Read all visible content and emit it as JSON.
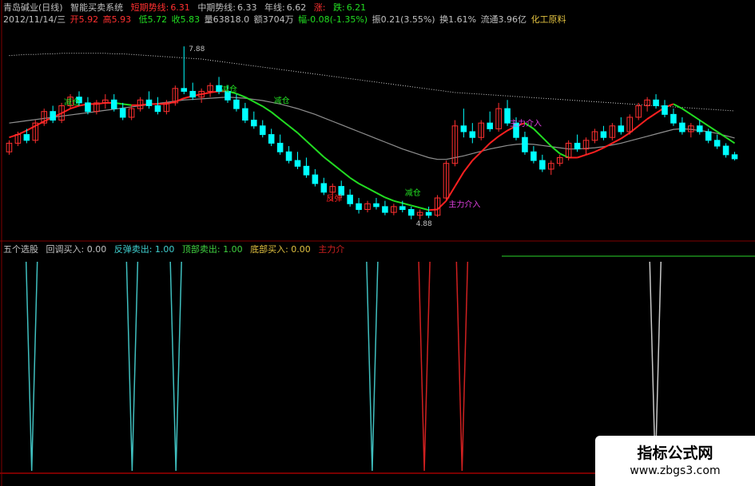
{
  "header": {
    "stock": "青岛碱业(日线)",
    "system": "智能买卖系统",
    "short_label": "短期势线:",
    "short_val": "6.31",
    "mid_label": "中期势线:",
    "mid_val": "6.33",
    "year_label": "年线:",
    "year_val": "6.62",
    "up_label": "涨:",
    "down_label": "跌:",
    "down_val": "6.21"
  },
  "quote": {
    "date": "2012/11/14/三",
    "open": "开5.92",
    "high": "高5.93",
    "low": "低5.72",
    "close": "收5.83",
    "vol": "量63818.0",
    "amount": "额3704万",
    "change": "幅-0.08(-1.35%)",
    "amplitude": "振0.21(3.55%)",
    "turnover": "换1.61%",
    "float": "流通3.96亿",
    "sector": "化工原料"
  },
  "indicator": {
    "name": "五个选股",
    "pullback": "回调买入: 0.00",
    "rebound": "反弹卖出: 1.00",
    "top": "顶部卖出: 1.00",
    "bottom": "底部买入: 0.00",
    "main": "主力介"
  },
  "colors": {
    "up": "#ff3030",
    "down": "#00ffff",
    "green_line": "#22dd22",
    "red_line": "#ff2020",
    "gray_line": "#909090",
    "dotted": "#d0d0d0",
    "cyan_spike": "#40c0c0",
    "red_spike": "#d02020",
    "white_spike": "#c8c8c8",
    "magenta": "#e040e0"
  },
  "chart_data": {
    "type": "candlestick",
    "price_markers": {
      "high": "7.88",
      "low": "4.88"
    },
    "annotations": [
      "减仓",
      "减仓",
      "减仓",
      "减仓",
      "反弹",
      "主力介入",
      "主力介入"
    ],
    "candles": [
      [
        6.05,
        6.25,
        6.0,
        6.2
      ],
      [
        6.2,
        6.4,
        6.15,
        6.35
      ],
      [
        6.35,
        6.45,
        6.2,
        6.25
      ],
      [
        6.25,
        6.6,
        6.2,
        6.55
      ],
      [
        6.55,
        6.8,
        6.5,
        6.75
      ],
      [
        6.75,
        6.85,
        6.55,
        6.6
      ],
      [
        6.6,
        6.9,
        6.55,
        6.85
      ],
      [
        6.85,
        7.05,
        6.8,
        7.0
      ],
      [
        7.0,
        7.1,
        6.85,
        6.9
      ],
      [
        6.9,
        7.0,
        6.7,
        6.75
      ],
      [
        6.75,
        6.95,
        6.7,
        6.9
      ],
      [
        6.9,
        7.05,
        6.8,
        6.95
      ],
      [
        6.95,
        7.05,
        6.75,
        6.8
      ],
      [
        6.8,
        6.9,
        6.6,
        6.65
      ],
      [
        6.65,
        6.85,
        6.6,
        6.8
      ],
      [
        6.8,
        7.0,
        6.75,
        6.95
      ],
      [
        6.95,
        7.1,
        6.8,
        6.85
      ],
      [
        6.85,
        7.0,
        6.7,
        6.75
      ],
      [
        6.75,
        6.95,
        6.7,
        6.9
      ],
      [
        6.9,
        7.2,
        6.85,
        7.15
      ],
      [
        7.15,
        7.88,
        7.05,
        7.1
      ],
      [
        7.1,
        7.25,
        6.95,
        7.0
      ],
      [
        7.0,
        7.15,
        6.9,
        7.1
      ],
      [
        7.1,
        7.25,
        7.0,
        7.2
      ],
      [
        7.2,
        7.35,
        7.05,
        7.1
      ],
      [
        7.1,
        7.2,
        6.9,
        6.95
      ],
      [
        6.95,
        7.05,
        6.75,
        6.8
      ],
      [
        6.8,
        6.9,
        6.55,
        6.6
      ],
      [
        6.6,
        6.75,
        6.45,
        6.5
      ],
      [
        6.5,
        6.6,
        6.3,
        6.35
      ],
      [
        6.35,
        6.45,
        6.15,
        6.2
      ],
      [
        6.2,
        6.35,
        6.0,
        6.05
      ],
      [
        6.05,
        6.15,
        5.85,
        5.9
      ],
      [
        5.9,
        6.05,
        5.75,
        5.8
      ],
      [
        5.8,
        5.95,
        5.6,
        5.65
      ],
      [
        5.65,
        5.75,
        5.45,
        5.5
      ],
      [
        5.5,
        5.6,
        5.3,
        5.35
      ],
      [
        5.35,
        5.5,
        5.2,
        5.45
      ],
      [
        5.45,
        5.55,
        5.25,
        5.3
      ],
      [
        5.3,
        5.4,
        5.1,
        5.15
      ],
      [
        5.15,
        5.25,
        4.98,
        5.05
      ],
      [
        5.05,
        5.2,
        5.0,
        5.15
      ],
      [
        5.15,
        5.25,
        5.05,
        5.1
      ],
      [
        5.1,
        5.2,
        4.95,
        5.0
      ],
      [
        5.0,
        5.15,
        4.95,
        5.1
      ],
      [
        5.1,
        5.2,
        5.0,
        5.05
      ],
      [
        5.05,
        5.1,
        4.88,
        4.95
      ],
      [
        4.95,
        5.05,
        4.88,
        5.0
      ],
      [
        5.0,
        5.1,
        4.9,
        4.95
      ],
      [
        4.95,
        5.3,
        4.92,
        5.25
      ],
      [
        5.25,
        5.9,
        5.2,
        5.85
      ],
      [
        5.85,
        6.6,
        5.8,
        6.5
      ],
      [
        6.5,
        6.8,
        6.3,
        6.4
      ],
      [
        6.4,
        6.55,
        6.2,
        6.3
      ],
      [
        6.3,
        6.6,
        6.25,
        6.55
      ],
      [
        6.55,
        6.75,
        6.4,
        6.45
      ],
      [
        6.45,
        6.9,
        6.4,
        6.8
      ],
      [
        6.8,
        6.95,
        6.5,
        6.55
      ],
      [
        6.55,
        6.65,
        6.25,
        6.3
      ],
      [
        6.3,
        6.4,
        6.0,
        6.05
      ],
      [
        6.05,
        6.15,
        5.85,
        5.9
      ],
      [
        5.9,
        6.0,
        5.7,
        5.75
      ],
      [
        5.75,
        5.9,
        5.65,
        5.85
      ],
      [
        5.85,
        6.0,
        5.8,
        5.95
      ],
      [
        5.95,
        6.25,
        5.9,
        6.2
      ],
      [
        6.2,
        6.35,
        6.05,
        6.1
      ],
      [
        6.1,
        6.3,
        6.0,
        6.25
      ],
      [
        6.25,
        6.45,
        6.2,
        6.4
      ],
      [
        6.4,
        6.5,
        6.25,
        6.3
      ],
      [
        6.3,
        6.55,
        6.25,
        6.5
      ],
      [
        6.5,
        6.65,
        6.35,
        6.4
      ],
      [
        6.4,
        6.7,
        6.35,
        6.65
      ],
      [
        6.65,
        6.9,
        6.6,
        6.85
      ],
      [
        6.85,
        7.0,
        6.75,
        6.95
      ],
      [
        6.95,
        7.05,
        6.8,
        6.85
      ],
      [
        6.85,
        6.95,
        6.65,
        6.7
      ],
      [
        6.7,
        6.8,
        6.5,
        6.55
      ],
      [
        6.55,
        6.65,
        6.35,
        6.4
      ],
      [
        6.4,
        6.55,
        6.3,
        6.5
      ],
      [
        6.5,
        6.6,
        6.35,
        6.4
      ],
      [
        6.4,
        6.45,
        6.2,
        6.25
      ],
      [
        6.25,
        6.35,
        6.1,
        6.15
      ],
      [
        6.15,
        6.2,
        5.95,
        6.0
      ],
      [
        6.0,
        6.05,
        5.9,
        5.93
      ]
    ],
    "ma_short": [
      6.3,
      6.35,
      6.42,
      6.5,
      6.58,
      6.65,
      6.72,
      6.8,
      6.85,
      6.88,
      6.88,
      6.9,
      6.9,
      6.88,
      6.86,
      6.86,
      6.88,
      6.88,
      6.88,
      6.92,
      6.98,
      7.02,
      7.05,
      7.08,
      7.1,
      7.1,
      7.06,
      7.0,
      6.92,
      6.84,
      6.74,
      6.62,
      6.5,
      6.38,
      6.24,
      6.1,
      5.96,
      5.84,
      5.72,
      5.6,
      5.5,
      5.42,
      5.34,
      5.26,
      5.2,
      5.16,
      5.12,
      5.08,
      5.04,
      5.05,
      5.2,
      5.45,
      5.7,
      5.9,
      6.05,
      6.2,
      6.32,
      6.42,
      6.5,
      6.55,
      6.45,
      6.3,
      6.15,
      6.02,
      5.95,
      5.95,
      6.0,
      6.05,
      6.12,
      6.2,
      6.28,
      6.38,
      6.5,
      6.62,
      6.72,
      6.82,
      6.88,
      6.8,
      6.7,
      6.6,
      6.5,
      6.4,
      6.3,
      6.2
    ],
    "ma_mid": [
      6.55,
      6.57,
      6.59,
      6.61,
      6.63,
      6.65,
      6.67,
      6.69,
      6.71,
      6.73,
      6.75,
      6.77,
      6.79,
      6.81,
      6.83,
      6.85,
      6.87,
      6.89,
      6.91,
      6.93,
      6.95,
      6.96,
      6.97,
      6.98,
      6.99,
      7.0,
      6.99,
      6.98,
      6.96,
      6.94,
      6.91,
      6.88,
      6.84,
      6.8,
      6.75,
      6.7,
      6.64,
      6.58,
      6.52,
      6.46,
      6.4,
      6.34,
      6.28,
      6.22,
      6.16,
      6.1,
      6.05,
      6.0,
      5.95,
      5.92,
      5.92,
      5.95,
      5.98,
      6.02,
      6.06,
      6.1,
      6.13,
      6.16,
      6.18,
      6.19,
      6.18,
      6.16,
      6.14,
      6.12,
      6.1,
      6.1,
      6.11,
      6.12,
      6.14,
      6.17,
      6.2,
      6.24,
      6.28,
      6.32,
      6.36,
      6.4,
      6.44,
      6.45,
      6.44,
      6.42,
      6.4,
      6.37,
      6.33,
      6.29
    ],
    "ma_year": [
      7.72,
      7.73,
      7.74,
      7.74,
      7.75,
      7.75,
      7.76,
      7.76,
      7.76,
      7.76,
      7.76,
      7.76,
      7.75,
      7.75,
      7.74,
      7.73,
      7.72,
      7.71,
      7.7,
      7.69,
      7.68,
      7.67,
      7.66,
      7.64,
      7.62,
      7.6,
      7.58,
      7.56,
      7.54,
      7.52,
      7.5,
      7.48,
      7.46,
      7.44,
      7.42,
      7.4,
      7.38,
      7.36,
      7.34,
      7.32,
      7.3,
      7.28,
      7.26,
      7.24,
      7.22,
      7.2,
      7.18,
      7.16,
      7.14,
      7.12,
      7.1,
      7.08,
      7.07,
      7.06,
      7.05,
      7.04,
      7.03,
      7.02,
      7.01,
      7.0,
      6.99,
      6.98,
      6.97,
      6.96,
      6.95,
      6.94,
      6.93,
      6.92,
      6.91,
      6.9,
      6.89,
      6.88,
      6.87,
      6.86,
      6.85,
      6.84,
      6.83,
      6.82,
      6.81,
      6.8,
      6.79,
      6.78,
      6.77,
      6.76
    ],
    "ylim": [
      4.6,
      8.2
    ],
    "spikes": [
      {
        "x": 0.042,
        "color": "cyan"
      },
      {
        "x": 0.175,
        "color": "cyan"
      },
      {
        "x": 0.233,
        "color": "cyan"
      },
      {
        "x": 0.493,
        "color": "cyan"
      },
      {
        "x": 0.562,
        "color": "red"
      },
      {
        "x": 0.612,
        "color": "red"
      },
      {
        "x": 0.868,
        "color": "white"
      }
    ]
  },
  "watermark": {
    "title": "指标公式网",
    "url": "www.zbgs3.com"
  }
}
